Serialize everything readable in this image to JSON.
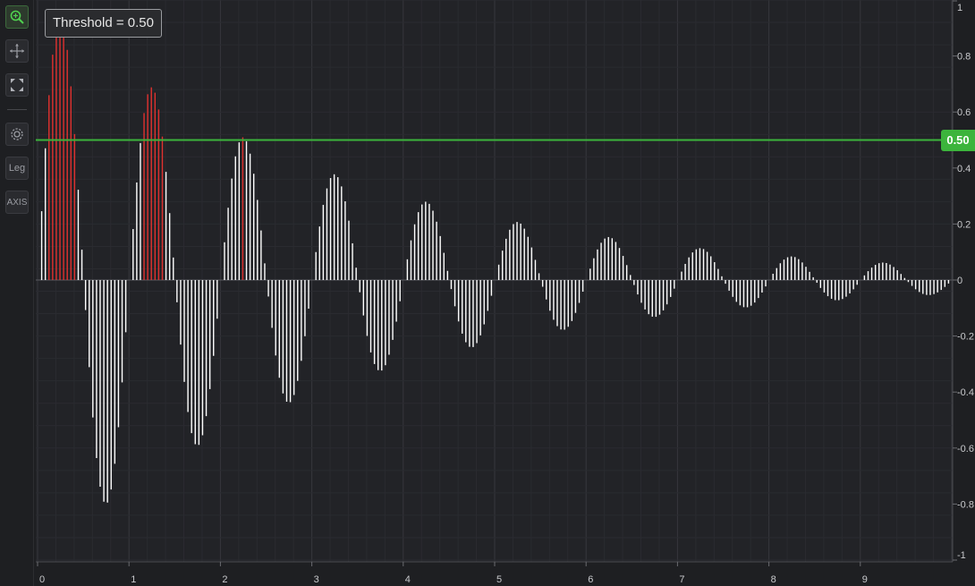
{
  "toolbar": {
    "zoom_icon": "zoom-icon",
    "pan_icon": "pan-icon",
    "fit_icon": "fit-screen-icon",
    "settings_icon": "gear-icon",
    "legend_label": "Leg",
    "axis_label": "AXIS"
  },
  "threshold": {
    "label": "Threshold = 0.50",
    "value_tag": "0.50",
    "color": "#3cb43c"
  },
  "colors": {
    "background": "#1e1f22",
    "below_threshold": "#ffffff",
    "above_threshold": "#e0312f"
  },
  "chart_data": {
    "type": "bar",
    "title": "",
    "xlabel": "",
    "ylabel": "",
    "xlim": [
      0,
      10
    ],
    "ylim": [
      -1,
      1
    ],
    "x_ticks": [
      "0",
      "1",
      "2",
      "3",
      "4",
      "5",
      "6",
      "7",
      "8",
      "9"
    ],
    "y_ticks": [
      "1",
      "0.8",
      "0.6",
      "0.4",
      "0.2",
      "0",
      "-0.2",
      "-0.4",
      "-0.6",
      "-0.8",
      "-1"
    ],
    "threshold": 0.5,
    "series": [
      {
        "signal": "damped_sine",
        "amplitude": 1.0,
        "frequency": 1.0,
        "decay_rate": 0.3,
        "sample_step": 0.04,
        "x_start": 0,
        "x_end": 9.96
      }
    ],
    "grid": true,
    "legend": "none"
  }
}
